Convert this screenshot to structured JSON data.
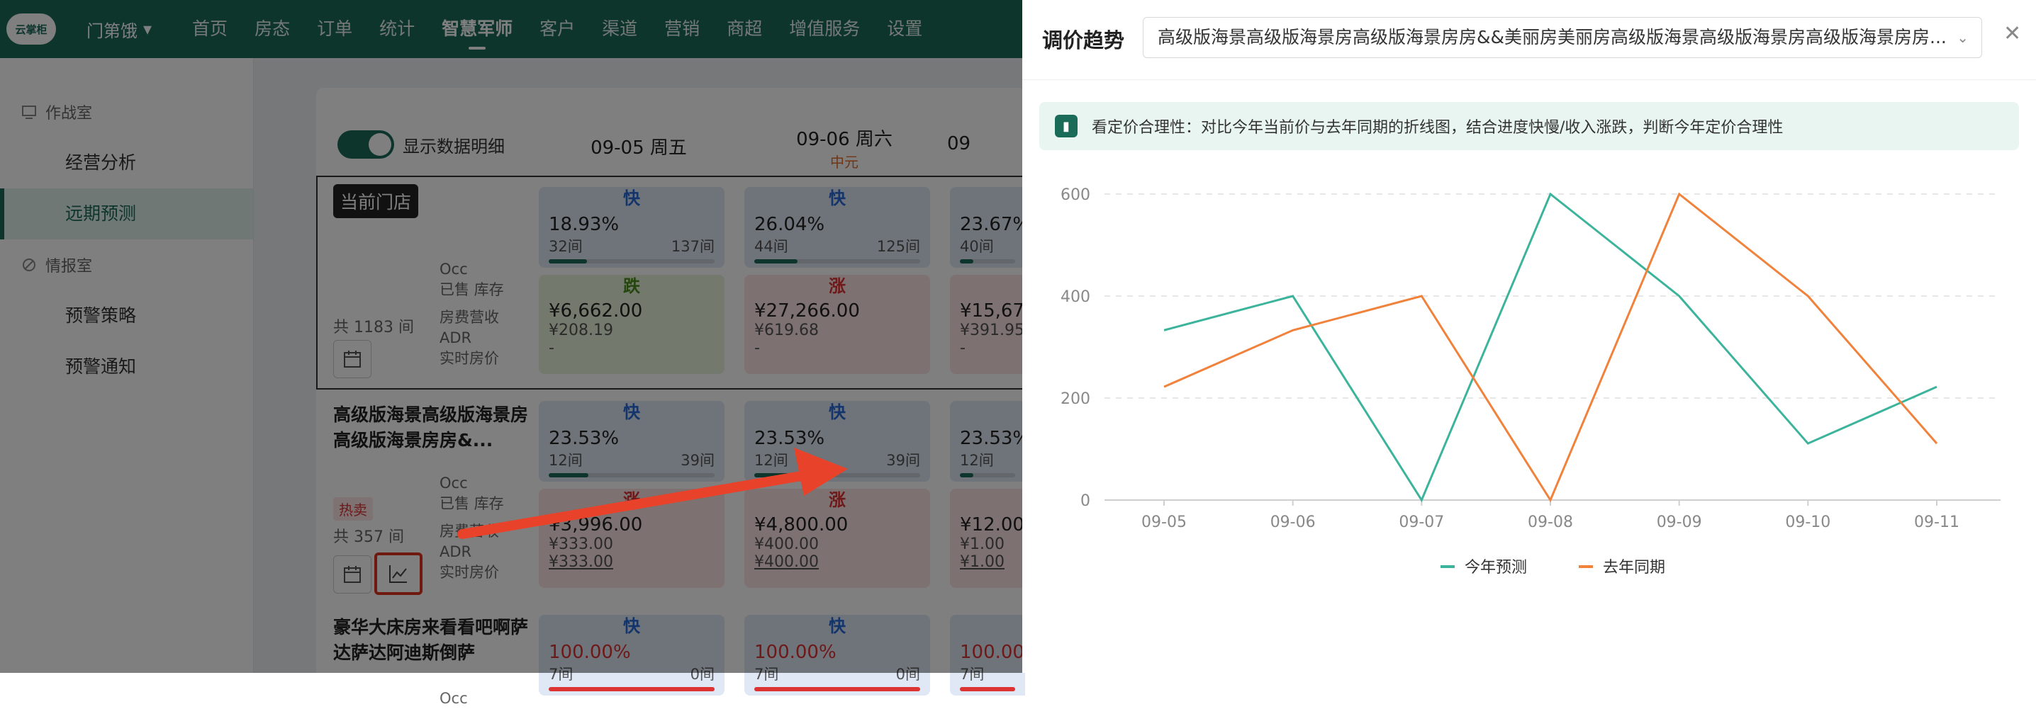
{
  "header": {
    "logo_text": "云掌柜",
    "store_name": "门第饿",
    "nav": [
      "首页",
      "房态",
      "订单",
      "统计",
      "智慧军师",
      "客户",
      "渠道",
      "营销",
      "商超",
      "增值服务",
      "设置"
    ],
    "active_nav": "智慧军师"
  },
  "sidebar": {
    "groups": [
      {
        "label": "作战室",
        "icon": "war-room-icon",
        "items": [
          "经营分析",
          "远期预测"
        ]
      },
      {
        "label": "情报室",
        "icon": "intel-room-icon",
        "items": [
          "预警策略",
          "预警通知"
        ]
      }
    ],
    "active_item": "远期预测"
  },
  "grid": {
    "toggle_label": "显示数据明细",
    "dates": [
      {
        "date": "09-05 周五",
        "note": ""
      },
      {
        "date": "09-06 周六",
        "note": "中元"
      },
      {
        "date": "09",
        "note": ""
      }
    ],
    "metric_labels": {
      "occ": "Occ",
      "sold_stock": "已售 库存",
      "revenue": "房费营收",
      "adr": "ADR",
      "live_price": "实时房价"
    },
    "rows": [
      {
        "name": "当前门店",
        "total": "共 1183 间",
        "cells": [
          {
            "trend": "快",
            "pct": "18.93%",
            "sold": "32间",
            "stock": "137间",
            "fill": 0.23,
            "change": "跌",
            "change_type": "down",
            "revenue": "¥6,662.00",
            "adr": "¥208.19",
            "live": "-"
          },
          {
            "trend": "快",
            "pct": "26.04%",
            "sold": "44间",
            "stock": "125间",
            "fill": 0.26,
            "change": "涨",
            "change_type": "up",
            "revenue": "¥27,266.00",
            "adr": "¥619.68",
            "live": "-"
          },
          {
            "trend": "快",
            "pct": "23.67%",
            "sold": "40间",
            "stock": "",
            "fill": 0.24,
            "change": "涨",
            "change_type": "up",
            "revenue": "¥15,67",
            "adr": "¥391.95",
            "live": "-"
          }
        ]
      },
      {
        "name": "高级版海景高级版海景房高级版海景房房&...",
        "tag": "热卖",
        "total": "共 357 间",
        "cells": [
          {
            "trend": "快",
            "pct": "23.53%",
            "sold": "12间",
            "stock": "39间",
            "fill": 0.24,
            "change": "涨",
            "change_type": "up",
            "revenue": "¥3,996.00",
            "adr": "¥333.00",
            "live": "¥333.00"
          },
          {
            "trend": "快",
            "pct": "23.53%",
            "sold": "12间",
            "stock": "39间",
            "fill": 0.24,
            "change": "涨",
            "change_type": "up",
            "revenue": "¥4,800.00",
            "adr": "¥400.00",
            "live": "¥400.00"
          },
          {
            "trend": "快",
            "pct": "23.53%",
            "sold": "12间",
            "stock": "",
            "fill": 0.24,
            "change": "涨",
            "change_type": "up",
            "revenue": "¥12.00",
            "adr": "¥1.00",
            "live": "¥1.00"
          }
        ]
      },
      {
        "name": "豪华大床房来看看吧啊萨达萨达阿迪斯倒萨",
        "total": "",
        "cells": [
          {
            "trend": "快",
            "pct": "100.00%",
            "sold": "7间",
            "stock": "0间",
            "fill": 1.0
          },
          {
            "trend": "快",
            "pct": "100.00%",
            "sold": "7间",
            "stock": "0间",
            "fill": 1.0
          },
          {
            "trend": "快",
            "pct": "100.00",
            "sold": "7间",
            "stock": "",
            "fill": 1.0
          }
        ]
      }
    ]
  },
  "panel": {
    "title": "调价趋势",
    "select_value": "高级版海景高级版海景房高级版海景房房&&美丽房美丽房高级版海景高级版海景房高级版海景房房...",
    "tip_text": "看定价合理性：对比今年当前价与去年同期的折线图，结合进度快慢/收入涨跌，判断今年定价合理性"
  },
  "chart_data": {
    "type": "line",
    "x": [
      "09-05",
      "09-06",
      "09-07",
      "09-08",
      "09-09",
      "09-10",
      "09-11"
    ],
    "series": [
      {
        "name": "今年预测",
        "values": [
          333,
          400,
          0,
          600,
          400,
          111,
          222
        ],
        "color": "#3cb49c"
      },
      {
        "name": "去年同期",
        "values": [
          222,
          333,
          400,
          0,
          600,
          400,
          111
        ],
        "color": "#f0823c"
      }
    ],
    "yticks": [
      0,
      200,
      400,
      600
    ],
    "ylim": [
      0,
      600
    ],
    "grid": true,
    "legend_position": "bottom-center"
  }
}
